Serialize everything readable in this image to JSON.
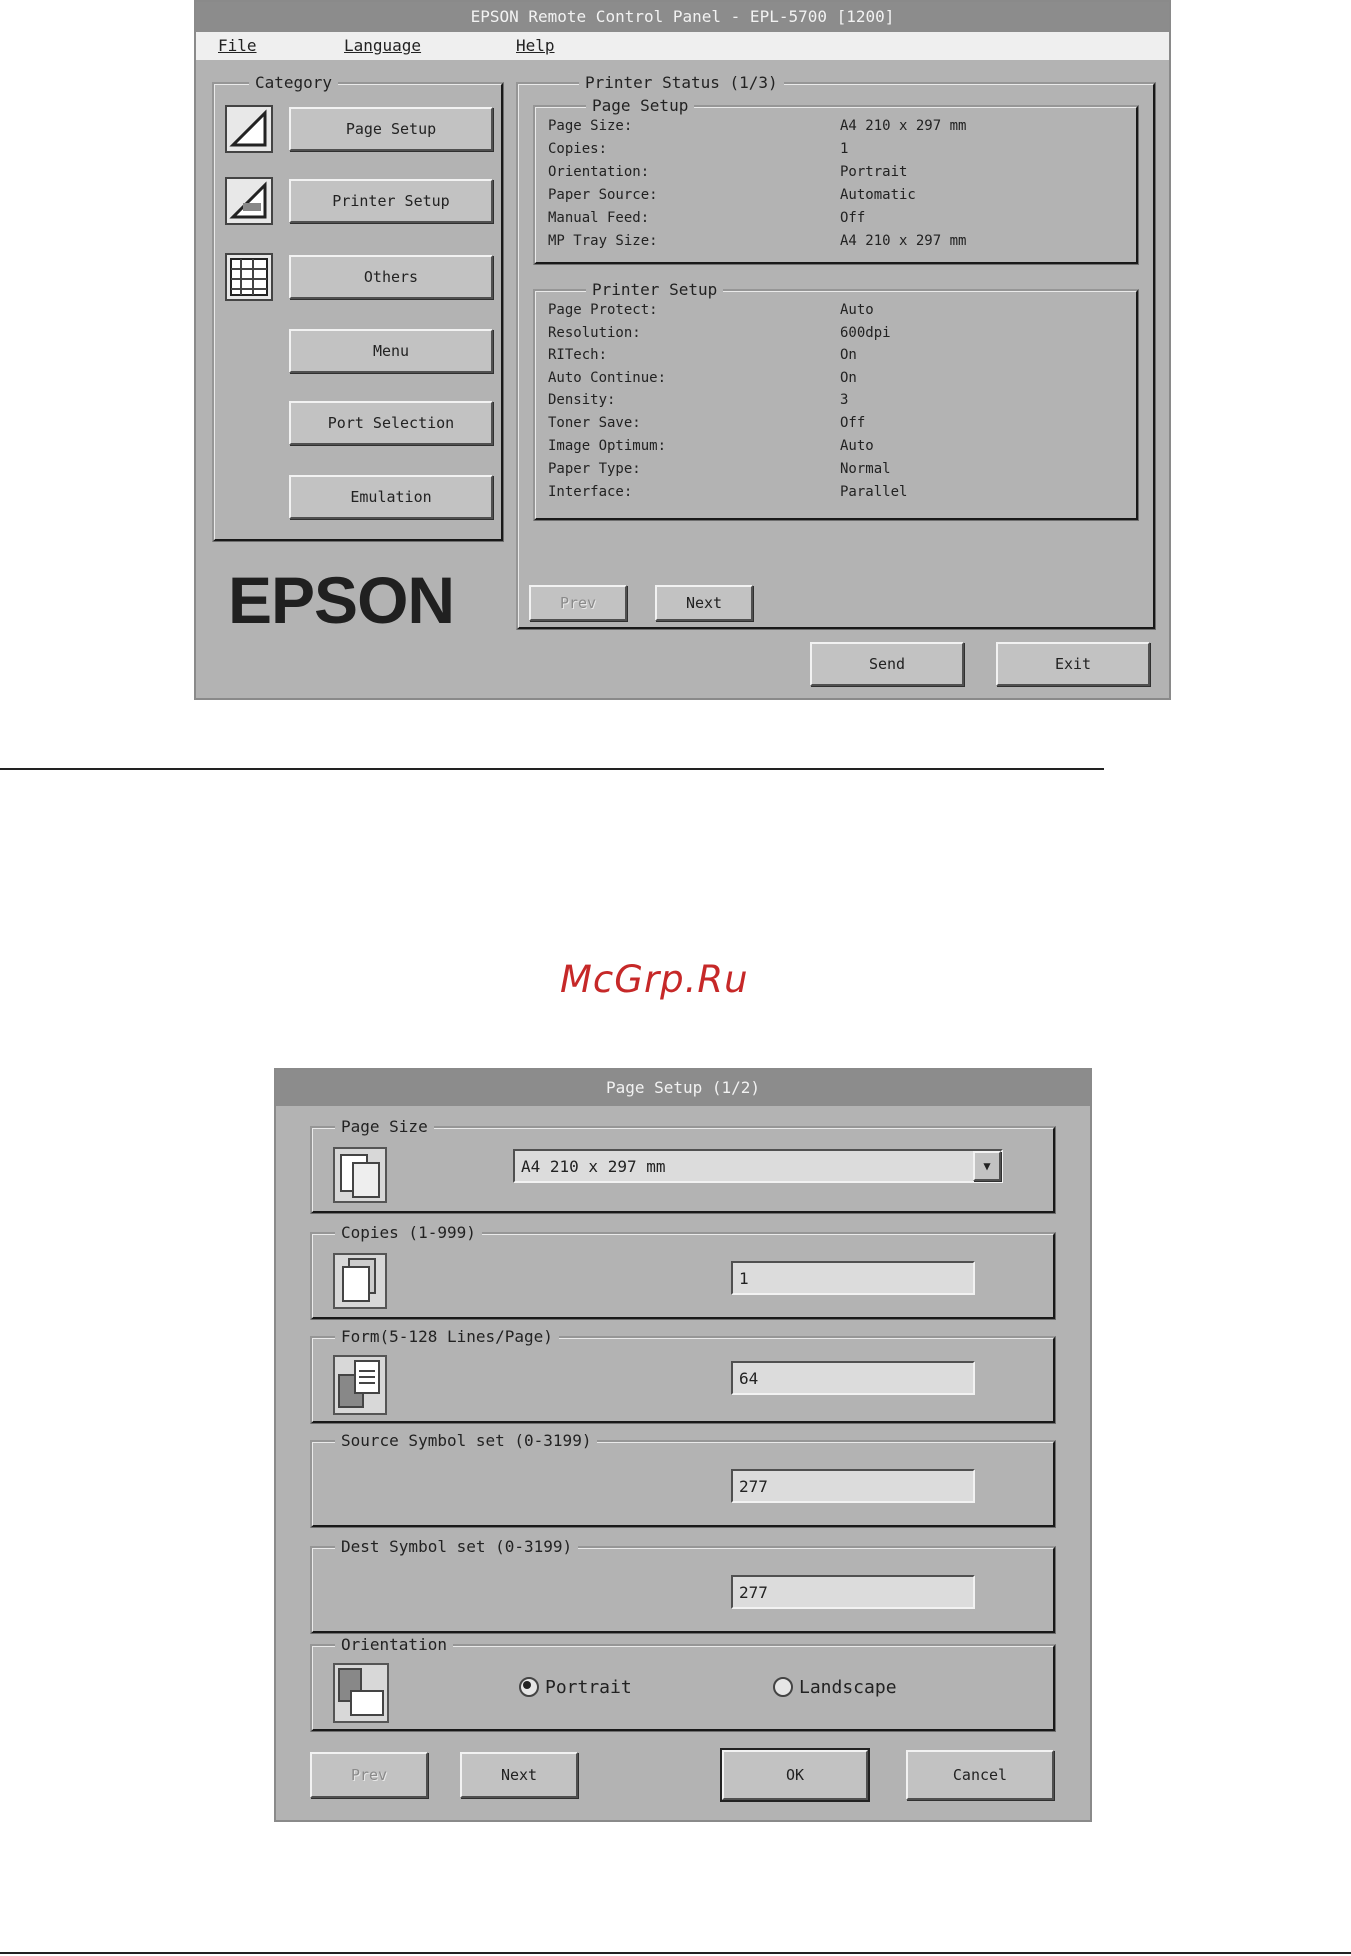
{
  "window1": {
    "title": "EPSON Remote Control Panel - EPL-5700 [1200]",
    "menu": [
      "File",
      "Language",
      "Help"
    ],
    "category": {
      "legend": "Category",
      "buttons": [
        "Page Setup",
        "Printer Setup",
        "Others",
        "Menu",
        "Port Selection",
        "Emulation"
      ]
    },
    "status": {
      "legend": "Printer Status (1/3)",
      "page_setup": {
        "legend": "Page Setup",
        "rows": [
          {
            "label": "Page Size:",
            "value": "A4 210 x 297 mm"
          },
          {
            "label": "Copies:",
            "value": "1"
          },
          {
            "label": "Orientation:",
            "value": "Portrait"
          },
          {
            "label": "Paper Source:",
            "value": "Automatic"
          },
          {
            "label": "Manual Feed:",
            "value": "Off"
          },
          {
            "label": "MP Tray Size:",
            "value": "A4 210 x 297 mm"
          }
        ]
      },
      "printer_setup": {
        "legend": "Printer Setup",
        "rows": [
          {
            "label": "Page Protect:",
            "value": "Auto"
          },
          {
            "label": "Resolution:",
            "value": "600dpi"
          },
          {
            "label": "RITech:",
            "value": "On"
          },
          {
            "label": "Auto Continue:",
            "value": "On"
          },
          {
            "label": "Density:",
            "value": "3"
          },
          {
            "label": "Toner Save:",
            "value": "Off"
          },
          {
            "label": "Image Optimum:",
            "value": "Auto"
          },
          {
            "label": "Paper Type:",
            "value": "Normal"
          },
          {
            "label": "Interface:",
            "value": "Parallel"
          }
        ]
      },
      "prev_label": "Prev",
      "next_label": "Next"
    },
    "logo": "EPSON",
    "send_label": "Send",
    "exit_label": "Exit"
  },
  "watermark": "McGrp.Ru",
  "window2": {
    "title": "Page Setup (1/2)",
    "page_size": {
      "legend": "Page Size",
      "value": "A4 210 x 297 mm"
    },
    "copies": {
      "legend": "Copies (1-999)",
      "value": "1"
    },
    "form": {
      "legend": "Form(5-128 Lines/Page)",
      "value": "64"
    },
    "source_symbol": {
      "legend": "Source Symbol set (0-3199)",
      "value": "277"
    },
    "dest_symbol": {
      "legend": "Dest Symbol set (0-3199)",
      "value": "277"
    },
    "orientation": {
      "legend": "Orientation",
      "portrait": "Portrait",
      "landscape": "Landscape",
      "selected": "portrait"
    },
    "prev_label": "Prev",
    "next_label": "Next",
    "ok_label": "OK",
    "cancel_label": "Cancel"
  }
}
